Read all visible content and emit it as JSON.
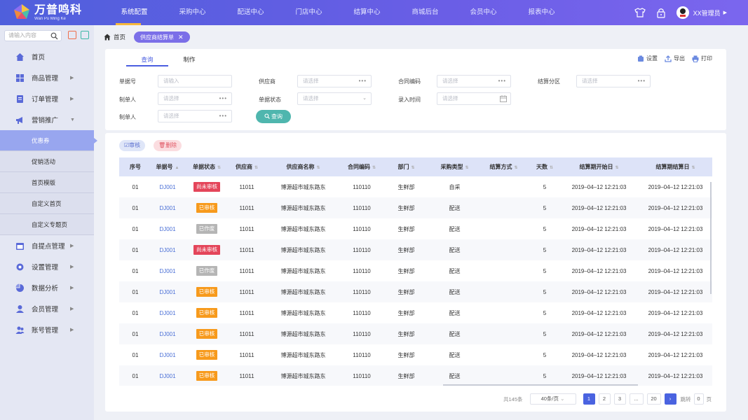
{
  "brand": {
    "name_cn": "万普鸣科",
    "name_en": "Wan Pu Ming Ke"
  },
  "nav": [
    "系统配置",
    "采购中心",
    "配送中心",
    "门店中心",
    "结算中心",
    "商城后台",
    "会员中心",
    "报表中心"
  ],
  "nav_active": 0,
  "user": {
    "name": "XX管理员"
  },
  "sidebar": {
    "search_placeholder": "请输入内容",
    "items": [
      {
        "label": "首页",
        "icon": "home-icon"
      },
      {
        "label": "商品管理",
        "icon": "grid-icon",
        "arrow": true
      },
      {
        "label": "订单管理",
        "icon": "order-icon",
        "arrow": true
      },
      {
        "label": "营销推广",
        "icon": "megaphone-icon",
        "arrow": true,
        "expanded": true
      }
    ],
    "sub_items": [
      "优惠券",
      "促销活动",
      "首页模版",
      "自定义首页",
      "自定义专题页"
    ],
    "sub_active": 0,
    "items_after": [
      {
        "label": "自提点管理",
        "icon": "calendar-icon"
      },
      {
        "label": "设置管理",
        "icon": "gear-icon"
      },
      {
        "label": "数据分析",
        "icon": "pie-chart-icon"
      },
      {
        "label": "会员管理",
        "icon": "member-icon"
      },
      {
        "label": "账号管理",
        "icon": "account-icon"
      }
    ]
  },
  "breadcrumb": {
    "home": "首页",
    "tab": "供应商结算单"
  },
  "tabs": [
    "查询",
    "制作"
  ],
  "tools": [
    "设置",
    "导出",
    "打印"
  ],
  "filters": {
    "order_no": {
      "label": "单据号",
      "placeholder": "请输入"
    },
    "supplier": {
      "label": "供应商",
      "placeholder": "请选择"
    },
    "contract": {
      "label": "合同编码",
      "placeholder": "请选择"
    },
    "partition": {
      "label": "结算分区",
      "placeholder": "请选择"
    },
    "creator": {
      "label": "制单人",
      "placeholder": "请选择"
    },
    "status": {
      "label": "单据状态",
      "placeholder": "请选择"
    },
    "entry_time": {
      "label": "录入时间",
      "placeholder": "请选择"
    },
    "creator2": {
      "label": "制单人",
      "placeholder": "请选择"
    },
    "query_button": "查询"
  },
  "actions": {
    "audit": "审核",
    "delete": "删除"
  },
  "table": {
    "headers": [
      "序号",
      "单据号",
      "单据状态",
      "供应商",
      "供应商名称",
      "合同编码",
      "部门",
      "采购类型",
      "结算方式",
      "天数",
      "结算期开始日",
      "结算期结算日"
    ],
    "rows": [
      {
        "no": "01",
        "code": "DJ001",
        "status": "尚未审核",
        "supplier": "11011",
        "name": "博源超市城东路东",
        "contract": "110110",
        "dept": "生鲜部",
        "type": "自采",
        "settle": "",
        "days": "5",
        "start": "2019–04–12  12:21:03",
        "end": "2019–04–12  12:21:03"
      },
      {
        "no": "01",
        "code": "DJ001",
        "status": "已审核",
        "supplier": "11011",
        "name": "博源超市城东路东",
        "contract": "110110",
        "dept": "生鲜部",
        "type": "配送",
        "settle": "",
        "days": "5",
        "start": "2019–04–12  12:21:03",
        "end": "2019–04–12  12:21:03"
      },
      {
        "no": "01",
        "code": "DJ001",
        "status": "已作废",
        "supplier": "11011",
        "name": "博源超市城东路东",
        "contract": "110110",
        "dept": "生鲜部",
        "type": "配送",
        "settle": "",
        "days": "5",
        "start": "2019–04–12  12:21:03",
        "end": "2019–04–12  12:21:03"
      },
      {
        "no": "01",
        "code": "DJ001",
        "status": "尚未审核",
        "supplier": "11011",
        "name": "博源超市城东路东",
        "contract": "110110",
        "dept": "生鲜部",
        "type": "配送",
        "settle": "",
        "days": "5",
        "start": "2019–04–12  12:21:03",
        "end": "2019–04–12  12:21:03"
      },
      {
        "no": "01",
        "code": "DJ001",
        "status": "已作废",
        "supplier": "11011",
        "name": "博源超市城东路东",
        "contract": "110110",
        "dept": "生鲜部",
        "type": "配送",
        "settle": "",
        "days": "5",
        "start": "2019–04–12  12:21:03",
        "end": "2019–04–12  12:21:03"
      },
      {
        "no": "01",
        "code": "DJ001",
        "status": "已审核",
        "supplier": "11011",
        "name": "博源超市城东路东",
        "contract": "110110",
        "dept": "生鲜部",
        "type": "配送",
        "settle": "",
        "days": "5",
        "start": "2019–04–12  12:21:03",
        "end": "2019–04–12  12:21:03"
      },
      {
        "no": "01",
        "code": "DJ001",
        "status": "已审核",
        "supplier": "11011",
        "name": "博源超市城东路东",
        "contract": "110110",
        "dept": "生鲜部",
        "type": "配送",
        "settle": "",
        "days": "5",
        "start": "2019–04–12  12:21:03",
        "end": "2019–04–12  12:21:03"
      },
      {
        "no": "01",
        "code": "DJ001",
        "status": "已审核",
        "supplier": "11011",
        "name": "博源超市城东路东",
        "contract": "110110",
        "dept": "生鲜部",
        "type": "配送",
        "settle": "",
        "days": "5",
        "start": "2019–04–12  12:21:03",
        "end": "2019–04–12  12:21:03"
      },
      {
        "no": "01",
        "code": "DJ001",
        "status": "已审核",
        "supplier": "11011",
        "name": "博源超市城东路东",
        "contract": "110110",
        "dept": "生鲜部",
        "type": "配送",
        "settle": "",
        "days": "5",
        "start": "2019–04–12  12:21:03",
        "end": "2019–04–12  12:21:03"
      },
      {
        "no": "01",
        "code": "DJ001",
        "status": "已审核",
        "supplier": "11011",
        "name": "博源超市城东路东",
        "contract": "110110",
        "dept": "生鲜部",
        "type": "配送",
        "settle": "",
        "days": "5",
        "start": "2019–04–12  12:21:03",
        "end": "2019–04–12  12:21:03"
      }
    ]
  },
  "status_colors": {
    "尚未审核": "#e4455a",
    "已审核": "#f79a1c",
    "已作废": "#b5b5b5"
  },
  "pagination": {
    "total": "共145条",
    "page_size": "40条/页",
    "pages": [
      "1",
      "2",
      "3",
      "...",
      "20"
    ],
    "current": "1",
    "next": "›",
    "jump_label": "跳转",
    "jump_value": "0",
    "page_unit": "页"
  }
}
